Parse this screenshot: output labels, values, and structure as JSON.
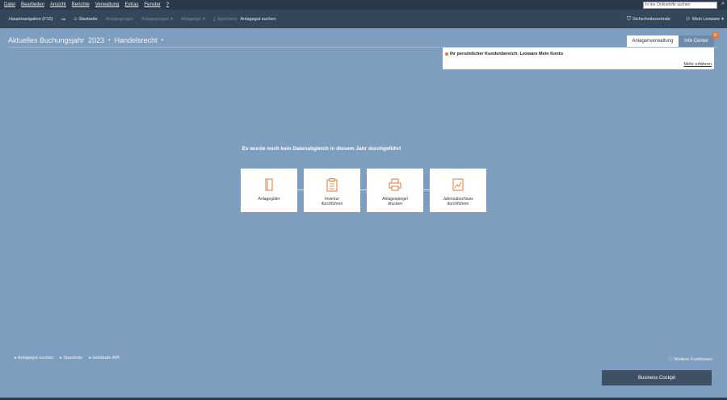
{
  "menubar": {
    "items": [
      "Datei",
      "Bearbeiten",
      "Ansicht",
      "Berichte",
      "Verwaltung",
      "Extras",
      "Fenster",
      "?"
    ],
    "search_placeholder": "In der Onlinehilfe suchen"
  },
  "toolbar": {
    "nav_label": "Hauptnavigation (F10)",
    "home_label": "Startseite",
    "disabled_1": "Anlagegruppe",
    "disabled_2": "Anlagegruppe",
    "disabled_3": "Anlagegut",
    "disabled_4": "Speichern",
    "search_asset_label": "Anlagegut suchen",
    "security_label": "Sicherheitszentrale",
    "account_label": "Mein Lexware"
  },
  "title": {
    "part1": "Aktuelles Buchungsjahr",
    "year": "2023",
    "law": "Handelsrecht"
  },
  "tabs": {
    "active": "Anlagenverwaltung",
    "inactive": "Info Center",
    "badge": "0"
  },
  "info_panel": {
    "text": "Ihr persönlicher Kundenbereich: Lexware Mein Konto",
    "more_link": "Mehr erfahren"
  },
  "center_message": "Es wurde noch kein Datenabgleich in diesem Jahr durchgeführt",
  "cards": [
    {
      "label_1": "Anlagegüter",
      "label_2": ""
    },
    {
      "label_1": "Inventur",
      "label_2": "durchführen"
    },
    {
      "label_1": "Anlagespiegel",
      "label_2": "drucken"
    },
    {
      "label_1": "Jahresabschluss",
      "label_2": "durchführen"
    }
  ],
  "bottom_links": [
    "Anlagegut suchen",
    "Standorte",
    "Gebäude-AfA"
  ],
  "bottom_right_link": "Weitere Funktionen",
  "cockpit_button": "Business Cockpit",
  "colors": {
    "background": "#7e9ec0",
    "menubar": "#2b3a4a",
    "toolbar": "#34465a",
    "accent": "#e07b3a",
    "cockpit": "#3d5064"
  }
}
